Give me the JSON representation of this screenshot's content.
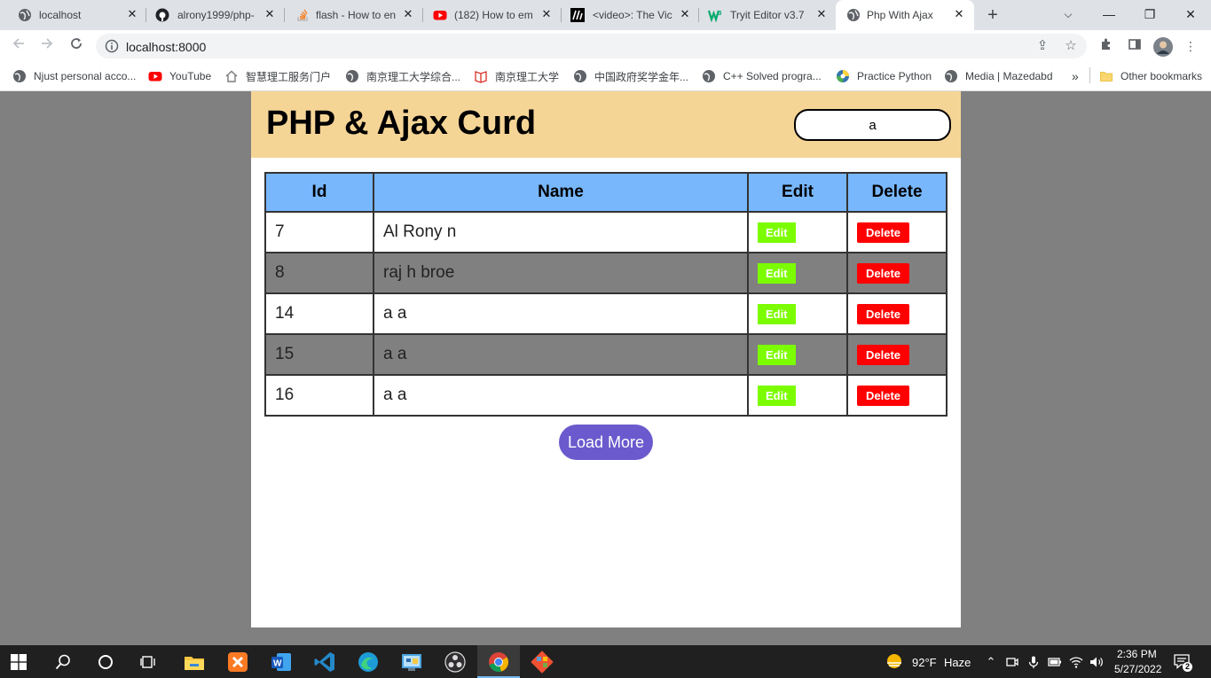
{
  "browser": {
    "tabs": [
      {
        "title": "localhost",
        "icon": "globe-icon"
      },
      {
        "title": "alrony1999/php-",
        "icon": "github-icon"
      },
      {
        "title": "flash - How to en",
        "icon": "stackoverflow-icon"
      },
      {
        "title": "(182) How to em",
        "icon": "youtube-icon"
      },
      {
        "title": "<video>: The Vic",
        "icon": "mdn-icon"
      },
      {
        "title": "Tryit Editor v3.7",
        "icon": "w3schools-icon"
      },
      {
        "title": "Php With Ajax",
        "icon": "globe-icon",
        "active": true
      }
    ],
    "url": "localhost:8000",
    "bookmarks": [
      {
        "label": "Njust personal acco...",
        "icon": "globe-icon"
      },
      {
        "label": "YouTube",
        "icon": "youtube-icon"
      },
      {
        "label": "智慧理工服务门户",
        "icon": "home-icon"
      },
      {
        "label": "南京理工大学综合...",
        "icon": "globe-icon"
      },
      {
        "label": "南京理工大学",
        "icon": "book-icon"
      },
      {
        "label": "中国政府奖学金年...",
        "icon": "globe-icon"
      },
      {
        "label": "C++ Solved progra...",
        "icon": "globe-icon"
      },
      {
        "label": "Practice Python",
        "icon": "python-icon"
      },
      {
        "label": "Media | Mazedabd",
        "icon": "globe-icon"
      }
    ],
    "more_bookmarks": "»",
    "other_bookmarks": "Other bookmarks"
  },
  "page": {
    "title": "PHP & Ajax Curd",
    "search_value": "a",
    "table": {
      "headers": [
        "Id",
        "Name",
        "Edit",
        "Delete"
      ],
      "rows": [
        {
          "id": "7",
          "name": "Al Rony n"
        },
        {
          "id": "8",
          "name": "raj h broe"
        },
        {
          "id": "14",
          "name": "a a"
        },
        {
          "id": "15",
          "name": "a a"
        },
        {
          "id": "16",
          "name": "a a"
        }
      ],
      "edit_label": "Edit",
      "delete_label": "Delete"
    },
    "load_more_label": "Load More"
  },
  "taskbar": {
    "weather_temp": "92°F",
    "weather_desc": "Haze",
    "time": "2:36 PM",
    "date": "5/27/2022",
    "notification_count": "2"
  },
  "colors": {
    "header_bg": "#f5d596",
    "table_head_bg": "#78b7fc",
    "edit_button": "#7cfc00",
    "delete_button": "#ff0000",
    "load_more_button": "#6a5acd",
    "alt_row": "#808080"
  }
}
